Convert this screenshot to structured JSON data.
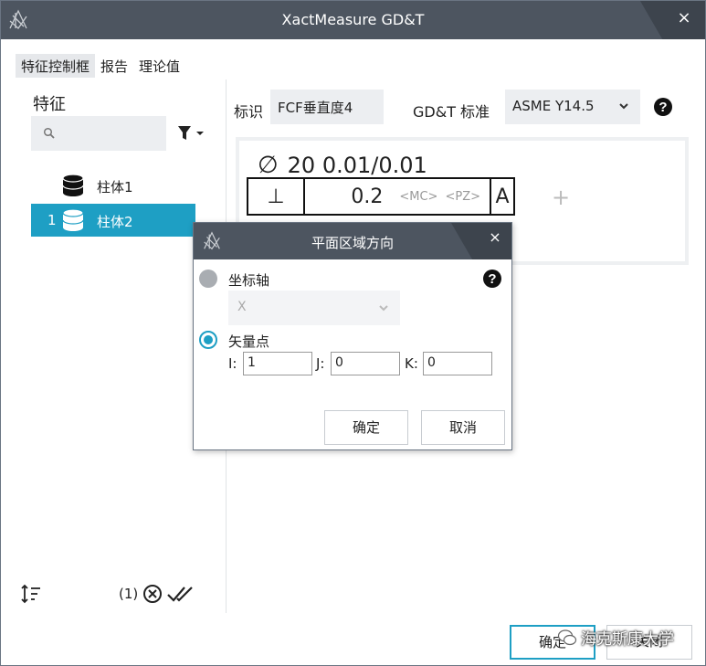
{
  "window": {
    "title": "XactMeasure GD&T",
    "close_glyph": "×"
  },
  "tabs": [
    {
      "label": "特征控制框",
      "active": true
    },
    {
      "label": "报告",
      "active": false
    },
    {
      "label": "理论值",
      "active": false
    }
  ],
  "left_panel": {
    "heading": "特征",
    "search": {
      "value": "",
      "placeholder": ""
    },
    "features": [
      {
        "index": "",
        "label": "柱体1",
        "icon": "cylinder-icon-dark",
        "selected": false
      },
      {
        "index": "1",
        "label": "柱体2",
        "icon": "cylinder-icon-light",
        "selected": true
      }
    ],
    "footer": {
      "count": "(1)"
    }
  },
  "right_panel": {
    "id_label": "标识",
    "id_value": "FCF垂直度4",
    "standard_label": "GD&T 标准",
    "standard_value": "ASME Y14.5"
  },
  "fcf": {
    "diameter_symbol": "∅",
    "size_text": "20 0.01/0.01",
    "characteristic_symbol": "⊥",
    "tolerance": "0.2",
    "modifier_mc": "<MC>",
    "modifier_pz": "<PZ>",
    "datum": "A",
    "add_glyph": "+"
  },
  "dialog": {
    "title": "平面区域方向",
    "close_glyph": "×",
    "option_axis": {
      "label": "坐标轴",
      "selected": false
    },
    "axis_value": "X",
    "option_vector": {
      "label": "矢量点",
      "selected": true
    },
    "i_label": "I:",
    "i_value": "1",
    "j_label": "J:",
    "j_value": "0",
    "k_label": "K:",
    "k_value": "0",
    "ok_label": "确定",
    "cancel_label": "取消"
  },
  "footer_buttons": {
    "ok_label": "确定",
    "close_label": "关闭"
  },
  "watermark": "海克斯康大学",
  "colors": {
    "accent": "#1e9fc4",
    "titlebar": "#4d5560",
    "input_bg": "#eceef1"
  }
}
